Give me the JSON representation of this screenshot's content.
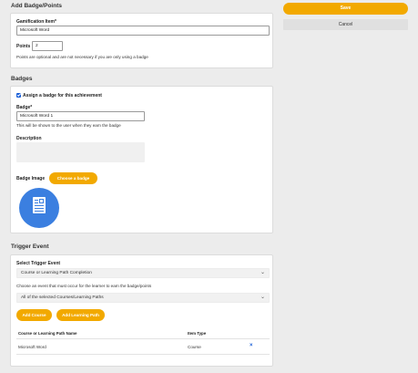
{
  "sections": {
    "add_badge_points": "Add Badge/Points",
    "badges": "Badges",
    "trigger_event": "Trigger Event"
  },
  "gamification": {
    "item_label": "Gamification Item*",
    "item_value": "Microsoft Word",
    "points_label": "Points",
    "points_value": "2",
    "points_help": "Points are optional and are not necessary if you are only using a badge"
  },
  "badges": {
    "assign_label": "Assign a badge for this achievement",
    "badge_label": "Badge*",
    "badge_value": "Microsoft Word 1",
    "badge_help": "This will be shown to the user when they earn the badge",
    "description_label": "Description",
    "image_label": "Badge Image",
    "choose_button": "Choose a badge"
  },
  "trigger": {
    "select_label": "Select Trigger Event",
    "select_value": "Course or Learning Path Completion",
    "event_help": "Choose an event that must occur for the learner to earn the badge/points",
    "scope_value": "All of the selected Courses/Learning Paths",
    "add_course_button": "Add Course",
    "add_path_button": "Add Learning Path",
    "table": {
      "columns": [
        "Course or Learning Path Name",
        "Item Type"
      ],
      "rows": [
        {
          "name": "Microsoft Word",
          "type": "Course"
        }
      ]
    }
  },
  "actions": {
    "save": "Save",
    "cancel": "Cancel"
  },
  "colors": {
    "accent": "#f2a900",
    "link": "#1a5fd8",
    "badge_bg": "#3b7fe0"
  },
  "icons": {
    "chevron": "chevron-down-icon",
    "remove": "close-icon",
    "badge": "document-badge-icon"
  }
}
